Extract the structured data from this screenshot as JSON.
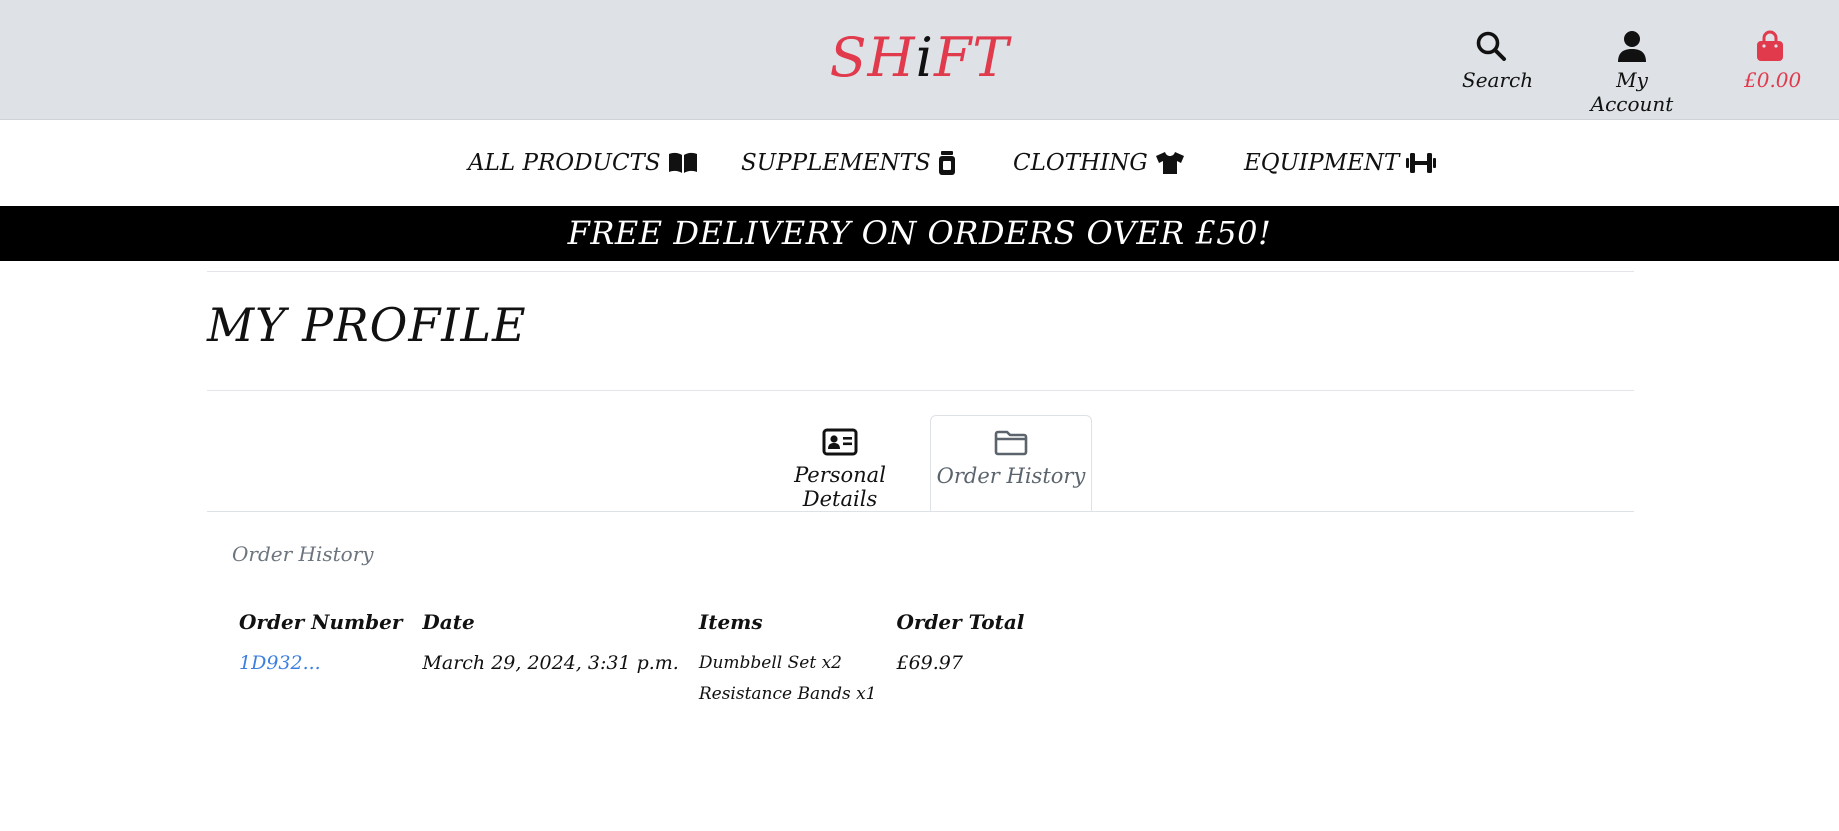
{
  "header": {
    "logo": {
      "part1": "SH",
      "part2": "i",
      "part3": "FT"
    },
    "search_label": "Search",
    "account_label": "My Account",
    "cart_total": "£0.00",
    "icons": {
      "search": "search-icon",
      "account": "user-icon",
      "cart": "shopping-bag-icon"
    }
  },
  "nav": {
    "items": [
      {
        "label": "ALL PRODUCTS",
        "icon": "book-icon"
      },
      {
        "label": "SUPPLEMENTS",
        "icon": "jar-icon"
      },
      {
        "label": "CLOTHING",
        "icon": "tshirt-icon"
      },
      {
        "label": "EQUIPMENT",
        "icon": "dumbbell-icon"
      }
    ]
  },
  "banner": {
    "text": "FREE DELIVERY ON ORDERS OVER £50!"
  },
  "profile": {
    "title": "MY PROFILE",
    "tabs": [
      {
        "label": "Personal Details",
        "icon": "id-card-icon",
        "active": false
      },
      {
        "label": "Order History",
        "icon": "folder-icon",
        "active": true
      }
    ]
  },
  "order_history": {
    "section_label": "Order History",
    "columns": [
      "Order Number",
      "Date",
      "Items",
      "Order Total"
    ],
    "rows": [
      {
        "order_number": "1D932...",
        "date": "March 29, 2024, 3:31 p.m.",
        "items": [
          "Dumbbell Set x2",
          "Resistance Bands x1"
        ],
        "total": "£69.97"
      }
    ]
  },
  "colors": {
    "brand": "#e03a4c",
    "header_bg": "#dee2e6",
    "banner_bg": "#000000",
    "link": "#3d7fe0",
    "muted": "#6c757d"
  }
}
